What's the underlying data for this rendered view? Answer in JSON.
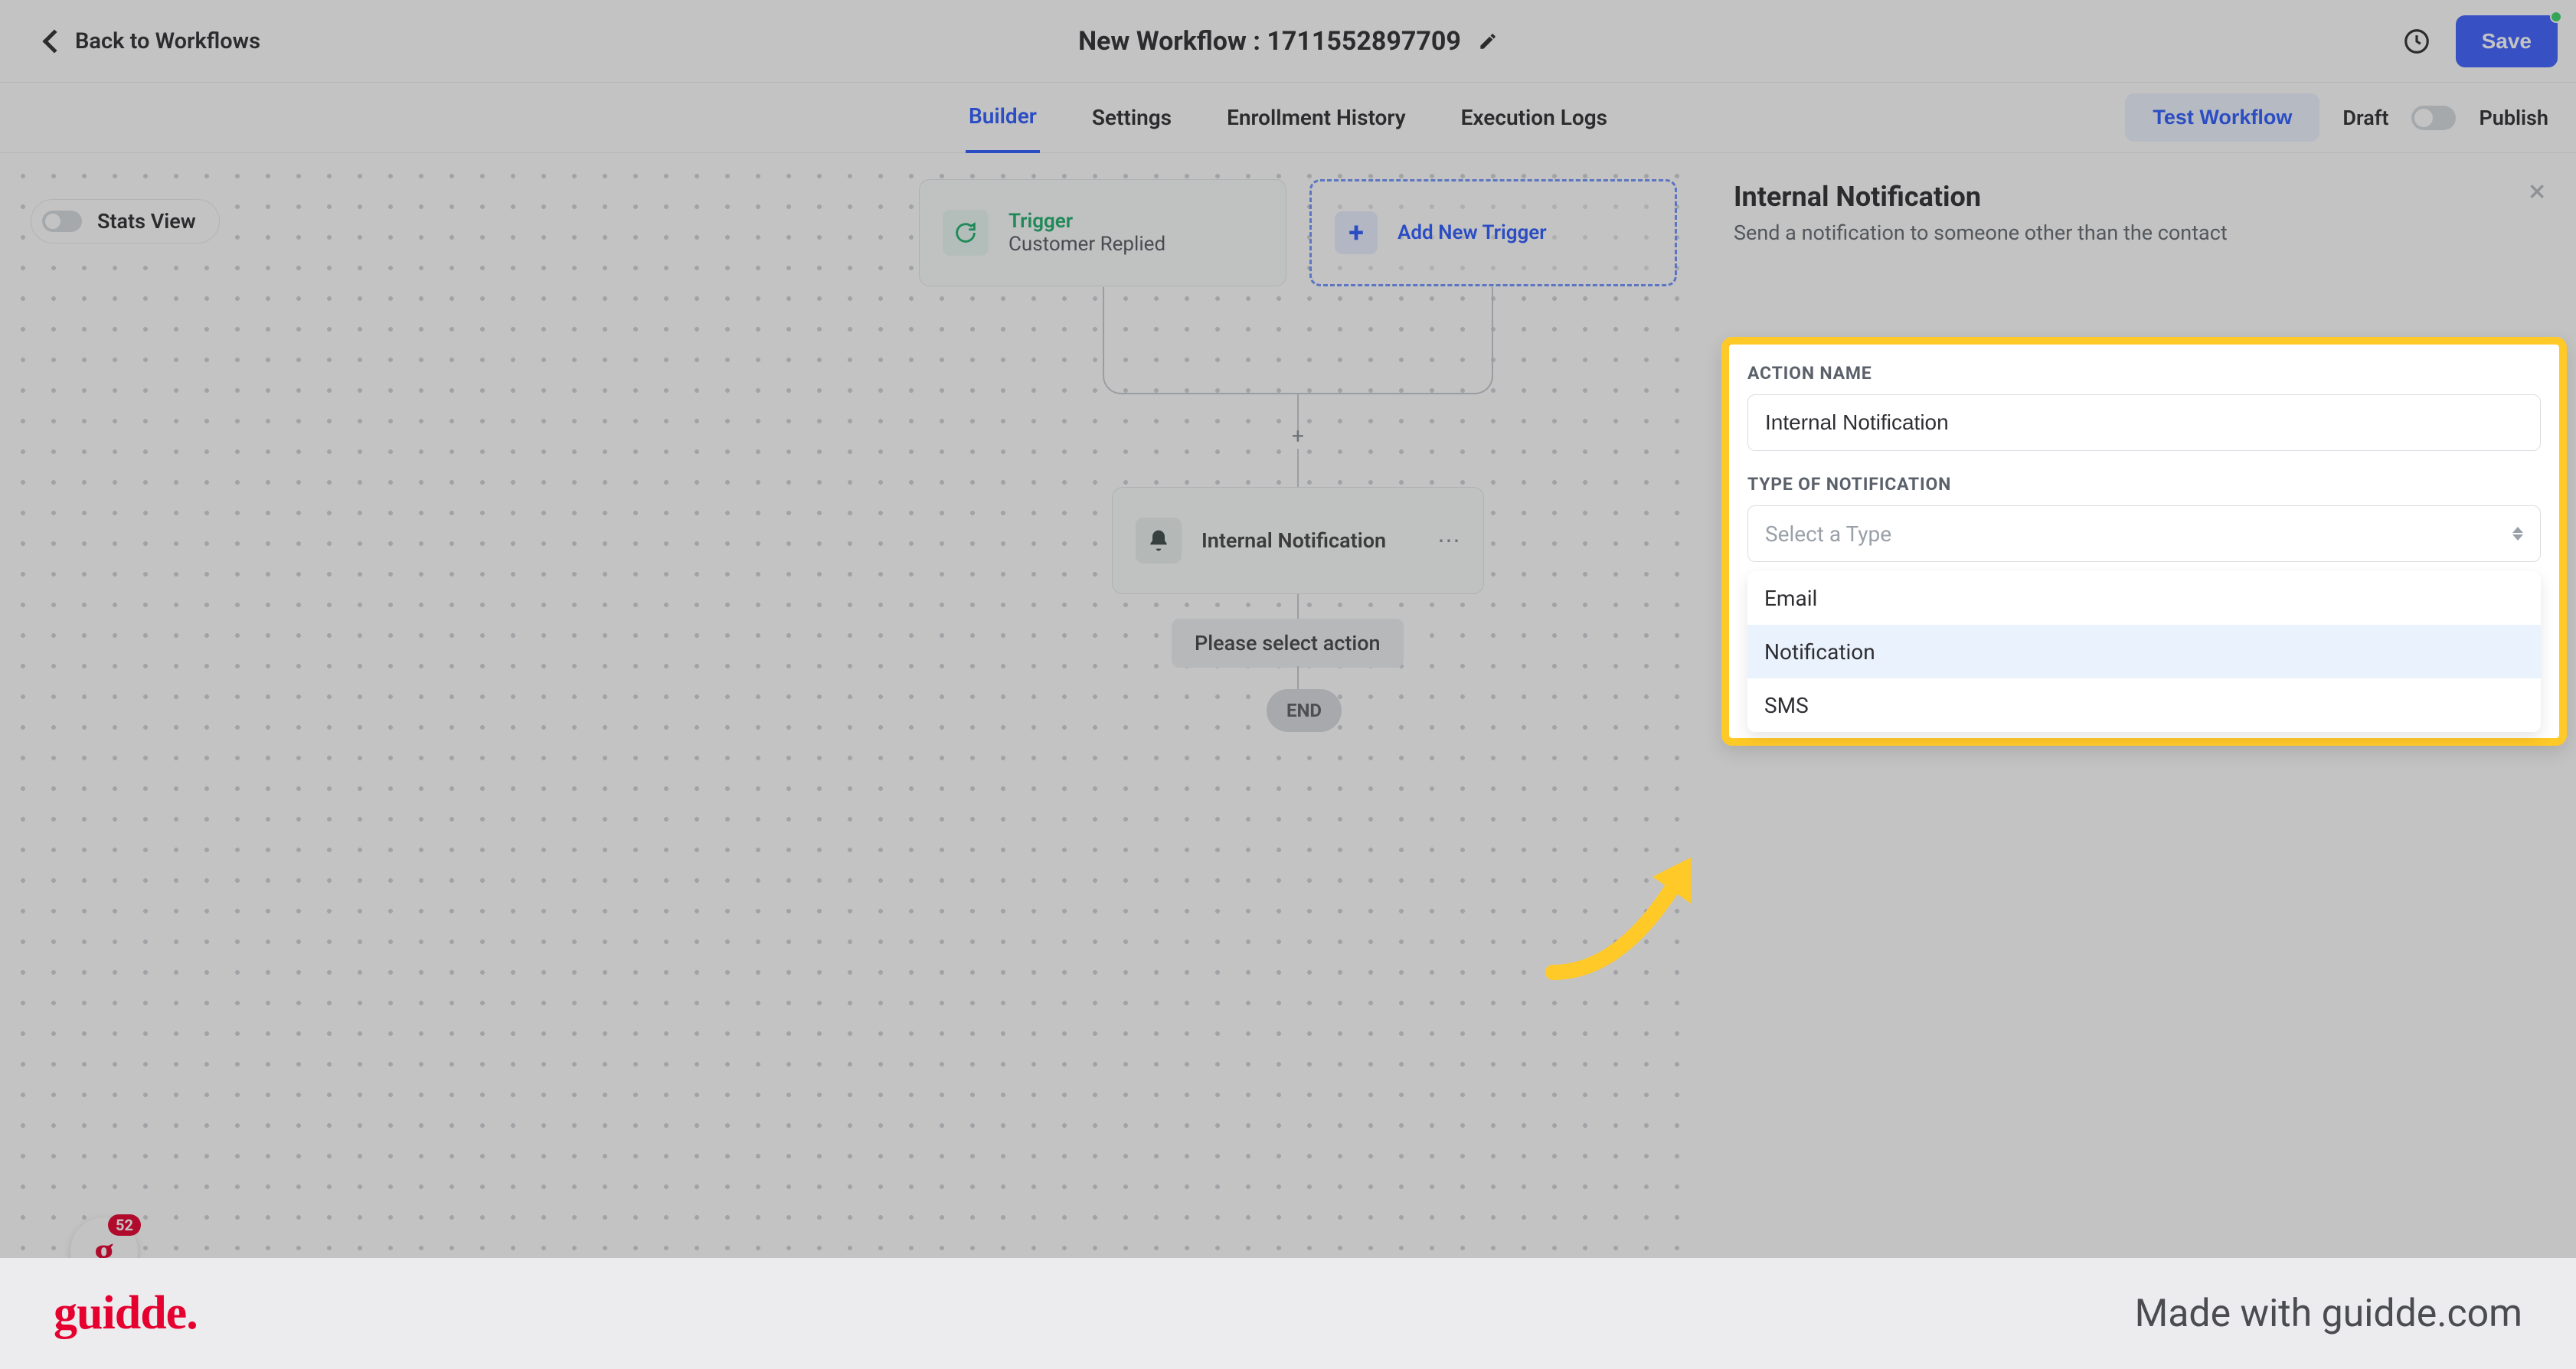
{
  "header": {
    "back_label": "Back to Workflows",
    "title": "New Workflow : 1711552897709",
    "save_label": "Save"
  },
  "tabs": {
    "items": [
      "Builder",
      "Settings",
      "Enrollment History",
      "Execution Logs"
    ],
    "active_index": 0,
    "test_label": "Test Workflow",
    "draft_label": "Draft",
    "publish_label": "Publish"
  },
  "canvas": {
    "stats_view_label": "Stats View",
    "trigger": {
      "title": "Trigger",
      "subtitle": "Customer Replied"
    },
    "add_trigger_label": "Add New Trigger",
    "action": {
      "label": "Internal Notification"
    },
    "select_action_label": "Please select action",
    "end_label": "END"
  },
  "panel": {
    "title": "Internal Notification",
    "subtitle": "Send a notification to someone other than the contact",
    "action_name_label": "ACTION NAME",
    "action_name_value": "Internal Notification",
    "type_label": "TYPE OF NOTIFICATION",
    "type_placeholder": "Select a Type",
    "options": [
      "Email",
      "Notification",
      "SMS"
    ],
    "hover_index": 1
  },
  "guidde": {
    "count": "52"
  },
  "brand": {
    "logo": "guidde.",
    "made_with": "Made with guidde.com"
  }
}
